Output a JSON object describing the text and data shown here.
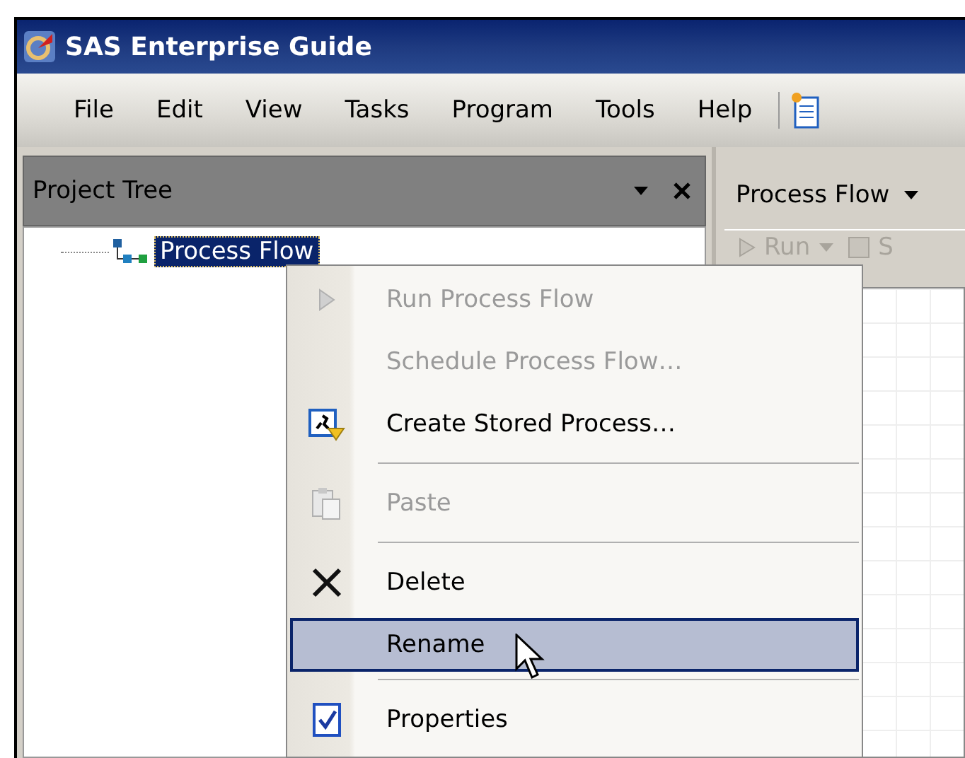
{
  "window": {
    "title": "SAS Enterprise Guide"
  },
  "menu_bar": [
    "File",
    "Edit",
    "View",
    "Tasks",
    "Program",
    "Tools",
    "Help"
  ],
  "project_tree": {
    "title": "Project Tree",
    "items": [
      {
        "label": "Process Flow",
        "selected": true
      }
    ]
  },
  "process_flow": {
    "tab": "Process Flow",
    "toolbar": [
      {
        "label": "Run",
        "disabled": true
      },
      {
        "label": "S",
        "disabled": true
      }
    ]
  },
  "context_menu": [
    {
      "kind": "item",
      "label": "Run Process Flow",
      "disabled": true,
      "selected": false
    },
    {
      "kind": "item",
      "label": "Schedule Process Flow…",
      "disabled": true,
      "selected": false
    },
    {
      "kind": "item",
      "label": "Create Stored Process…",
      "disabled": false,
      "selected": false
    },
    {
      "kind": "separator"
    },
    {
      "kind": "item",
      "label": "Paste",
      "disabled": true,
      "selected": false
    },
    {
      "kind": "separator"
    },
    {
      "kind": "item",
      "label": "Delete",
      "disabled": false,
      "selected": false
    },
    {
      "kind": "item",
      "label": "Rename",
      "disabled": false,
      "selected": true
    },
    {
      "kind": "separator"
    },
    {
      "kind": "item",
      "label": "Properties",
      "disabled": false,
      "selected": false
    }
  ]
}
